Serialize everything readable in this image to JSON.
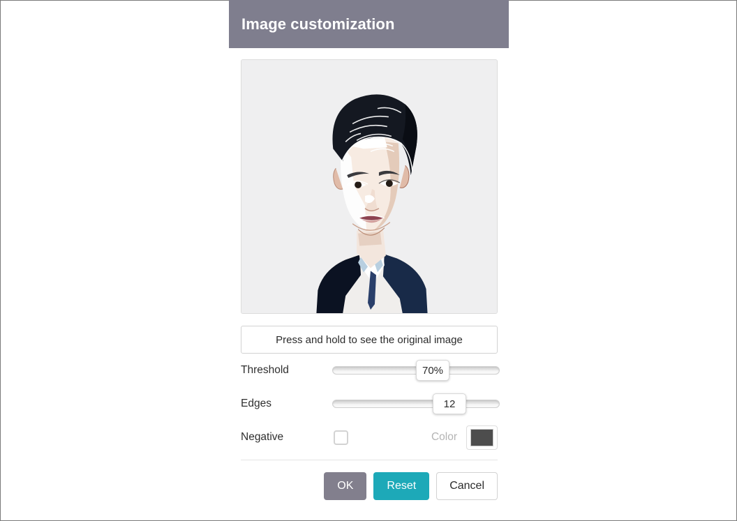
{
  "dialog": {
    "title": "Image customization",
    "preview": {
      "alt": "stylized-portrait-preview",
      "background_color": "#efeff0"
    },
    "original_button": {
      "label": "Press and hold to see the original image"
    },
    "controls": [
      {
        "name": "threshold",
        "label": "Threshold",
        "type": "slider",
        "value": "70%",
        "percent": 60
      },
      {
        "name": "edges",
        "label": "Edges",
        "type": "slider",
        "value": "12",
        "percent": 70
      }
    ],
    "negative": {
      "label": "Negative",
      "checked": false
    },
    "color": {
      "label": "Color",
      "swatch_hex": "#4d4d4d",
      "disabled": true
    },
    "footer": {
      "ok_label": "OK",
      "reset_label": "Reset",
      "cancel_label": "Cancel"
    }
  },
  "theme": {
    "header_bg": "#7f7e8e",
    "ok_bg": "#827f8d",
    "reset_bg": "#1da9b8",
    "page_bg": "#ffffff"
  }
}
